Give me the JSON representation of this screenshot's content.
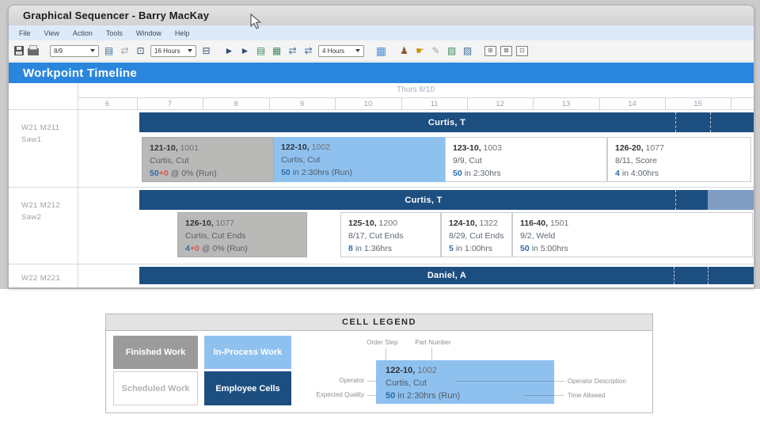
{
  "window": {
    "title": "Graphical Sequencer  -  Barry MacKay"
  },
  "menu": {
    "items": [
      "File",
      "View",
      "Action",
      "Tools",
      "Window",
      "Help"
    ]
  },
  "toolbar": {
    "date_value": "8/9",
    "span_value": "16 Hours",
    "interval_value": "4 Hours",
    "icons": {
      "page": "▤",
      "link": "⇄",
      "monitor": "⊡",
      "export": "⊟",
      "advance": "►",
      "advance_all": "►",
      "sequence_up": "▤",
      "sequence_down": "▦",
      "swap_left": "⇄",
      "swap_right": "⇄",
      "grid": "▦",
      "people": "♟",
      "hand": "☛",
      "edit": "✎",
      "chart_a": "▧",
      "chart_b": "▨",
      "layout_1": "⊞",
      "layout_2": "⊠",
      "layout_3": "⊡"
    }
  },
  "timeline": {
    "title": "Workpoint Timeline",
    "date_header": "Thurs 8/10",
    "hours": [
      "6",
      "7",
      "8",
      "9",
      "10",
      "11",
      "12",
      "13",
      "14",
      "15"
    ],
    "rows": [
      {
        "label1": "W21 M211",
        "label2": "Saw1",
        "employee": "Curtis, T"
      },
      {
        "label1": "W21 M212",
        "label2": "Saw2",
        "employee": "Curtis, T"
      },
      {
        "label1": "W22 M221",
        "label2": "",
        "employee": "Daniel, A"
      }
    ],
    "cells": {
      "r1c1": {
        "step": "121-10,",
        "part": "1001",
        "desc": "Curtis, Cut",
        "qty": "50",
        "plus": "+0",
        "rest": "@ 0% (Run)"
      },
      "r1c2": {
        "step": "122-10,",
        "part": "1002",
        "desc": "Curtis, Cut",
        "qty": "50",
        "rest": "in 2:30hrs (Run)"
      },
      "r1c3": {
        "step": "123-10,",
        "part": "1003",
        "desc": "9/9, Cut",
        "qty": "50",
        "rest": "in 2:30hrs"
      },
      "r1c4": {
        "step": "126-20,",
        "part": "1077",
        "desc": "8/11, Score",
        "qty": "4",
        "rest": "in 4:00hrs"
      },
      "r2c1": {
        "step": "126-10,",
        "part": "1077",
        "desc": "Curtis, Cut Ends",
        "qty": "4",
        "plus": "+0",
        "rest": "@ 0% (Run)"
      },
      "r2c2": {
        "step": "125-10,",
        "part": "1200",
        "desc": "8/17, Cut Ends",
        "qty": "8",
        "rest": "in 1:36hrs"
      },
      "r2c3": {
        "step": "124-10,",
        "part": "1322",
        "desc": "8/29, Cut Ends",
        "qty": "5",
        "rest": "in 1:00hrs"
      },
      "r2c4": {
        "step": "116-40,",
        "part": "1501",
        "desc": "9/2, Weld",
        "qty": "50",
        "rest": "in 5:00hrs"
      }
    }
  },
  "legend": {
    "title": "CELL LEGEND",
    "swatches": [
      {
        "label": "Finished Work"
      },
      {
        "label": "In-Process Work"
      },
      {
        "label": "Scheduled Work"
      },
      {
        "label": "Employee Cells"
      }
    ],
    "sample": {
      "step": "122-10,",
      "part": "1002",
      "desc": "Curtis, Cut",
      "qty": "50",
      "rest": "in 2:30hrs (Run)"
    },
    "callouts": {
      "order_step": "Order Step",
      "part_number": "Part Number",
      "operator": "Operator",
      "expected_quality": "Expected Quality",
      "operator_description": "Operator Description",
      "time_allowed": "Time Allowed"
    }
  },
  "colors": {
    "accent_blue": "#2a86dd",
    "employee_navy": "#1d4e80",
    "inprocess_blue": "#8fc1ef",
    "finished_gray": "#b9b9b8",
    "overtime_steel": "#7e9dc1",
    "qty_blue": "#2e6cab",
    "plus_red": "#dd5248"
  }
}
